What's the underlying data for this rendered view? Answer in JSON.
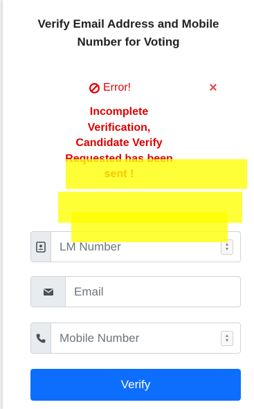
{
  "form": {
    "title_line1": "Verify Email Address and Mobile",
    "title_line2": "Number for Voting",
    "error": {
      "heading": "Error!",
      "message_lines": [
        "Incomplete",
        "Verification,",
        "Candidate Verify",
        "Requested has been",
        "sent !"
      ],
      "close_symbol": "×"
    },
    "fields": {
      "lm_number": {
        "placeholder": "LM Number",
        "value": "",
        "icon": "id-card-icon"
      },
      "email": {
        "placeholder": "Email",
        "value": "",
        "icon": "envelope-icon"
      },
      "mobile": {
        "placeholder": "Mobile Number",
        "value": "",
        "icon": "phone-icon"
      }
    },
    "verify_label": "Verify"
  },
  "colors": {
    "error": "#e00000",
    "close": "#e5484d",
    "primary": "#0d6efd",
    "highlight": "#ffff00"
  }
}
